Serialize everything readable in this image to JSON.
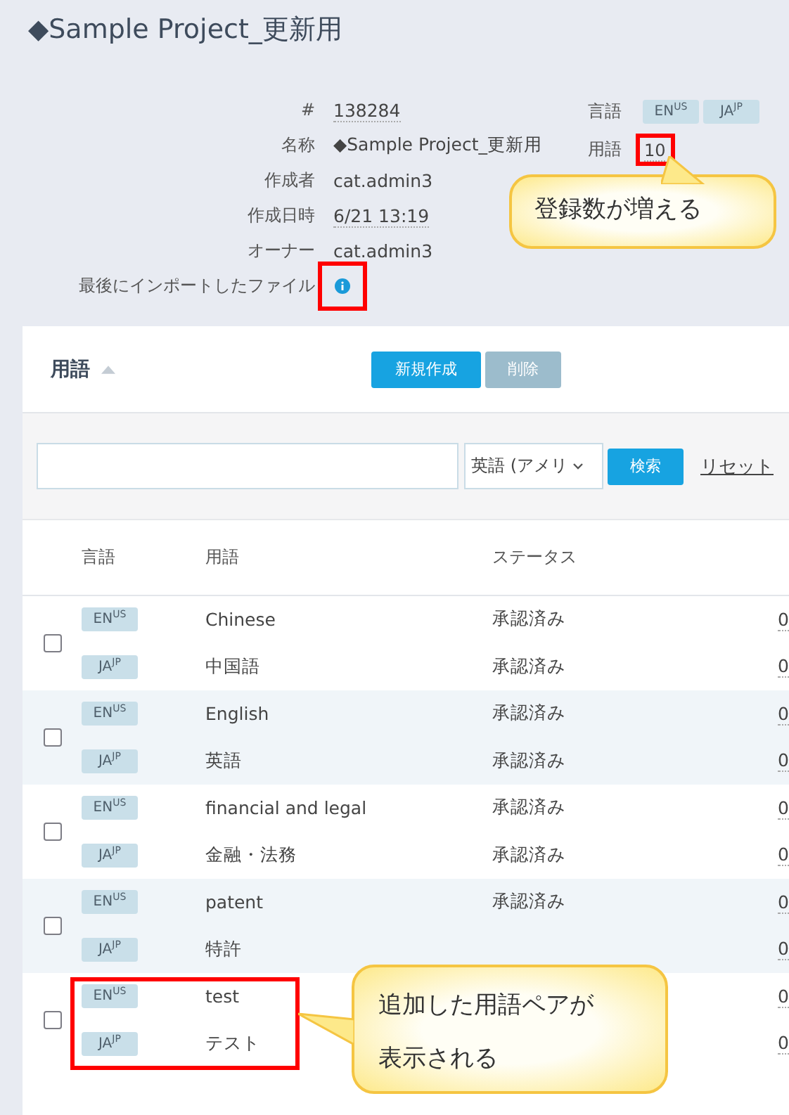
{
  "title": "◆Sample Project_更新用",
  "meta": [
    {
      "label": "#",
      "value": "138284",
      "underlined": true,
      "kind": "text",
      "highlighted": false
    },
    {
      "label": "名称",
      "value": "◆Sample Project_更新用",
      "underlined": false,
      "kind": "text",
      "highlighted": false
    },
    {
      "label": "作成者",
      "value": "cat.admin3",
      "underlined": false,
      "kind": "text",
      "highlighted": false
    },
    {
      "label": "作成日時",
      "value": "6/21 13:19",
      "underlined": true,
      "kind": "text",
      "highlighted": false
    },
    {
      "label": "オーナー",
      "value": "cat.admin3",
      "underlined": false,
      "kind": "text",
      "highlighted": false
    },
    {
      "label": "最後にインポートしたファイル",
      "kind": "info",
      "highlighted": true
    }
  ],
  "summary": {
    "languages_label": "言語",
    "languages": [
      {
        "code": "EN",
        "region": "US"
      },
      {
        "code": "JA",
        "region": "JP"
      }
    ],
    "terms_label": "用語",
    "terms_count": "10",
    "terms_highlighted": true
  },
  "panel": {
    "title": "用語",
    "buttons": [
      {
        "label": "新規作成",
        "disabled": false
      },
      {
        "label": "削除",
        "disabled": true
      }
    ],
    "search": {
      "language": "英語 (アメリ",
      "search_button": "検索",
      "reset_link": "リセット"
    }
  },
  "table": {
    "columns": [
      "言語",
      "用語",
      "ステータス"
    ],
    "rows": [
      {
        "checked": false,
        "highlighted": false,
        "entries": [
          {
            "code": "EN",
            "region": "US",
            "term": "Chinese",
            "status": "承認済み",
            "column_4": "0"
          },
          {
            "code": "JA",
            "region": "JP",
            "term": "中国語",
            "status": "承認済み",
            "column_4": "0"
          }
        ]
      },
      {
        "checked": false,
        "highlighted": false,
        "entries": [
          {
            "code": "EN",
            "region": "US",
            "term": "English",
            "status": "承認済み",
            "column_4": "0"
          },
          {
            "code": "JA",
            "region": "JP",
            "term": "英語",
            "status": "承認済み",
            "column_4": "0"
          }
        ]
      },
      {
        "checked": false,
        "highlighted": false,
        "entries": [
          {
            "code": "EN",
            "region": "US",
            "term": "financial and legal",
            "status": "承認済み",
            "column_4": "0"
          },
          {
            "code": "JA",
            "region": "JP",
            "term": "金融・法務",
            "status": "承認済み",
            "column_4": "0"
          }
        ]
      },
      {
        "checked": false,
        "highlighted": false,
        "entries": [
          {
            "code": "EN",
            "region": "US",
            "term": "patent",
            "status": "承認済み",
            "column_4": "0"
          },
          {
            "code": "JA",
            "region": "JP",
            "term": "特許",
            "column_4": "0"
          }
        ]
      },
      {
        "checked": false,
        "highlighted": true,
        "entries": [
          {
            "code": "EN",
            "region": "US",
            "term": "test",
            "column_4": "0"
          },
          {
            "code": "JA",
            "region": "JP",
            "term": "テスト",
            "column_4": "0"
          }
        ]
      }
    ]
  },
  "callouts": [
    {
      "lines": [
        "登録数が増える"
      ]
    },
    {
      "lines": [
        "追加した用語ペアが",
        "表示される"
      ]
    }
  ]
}
